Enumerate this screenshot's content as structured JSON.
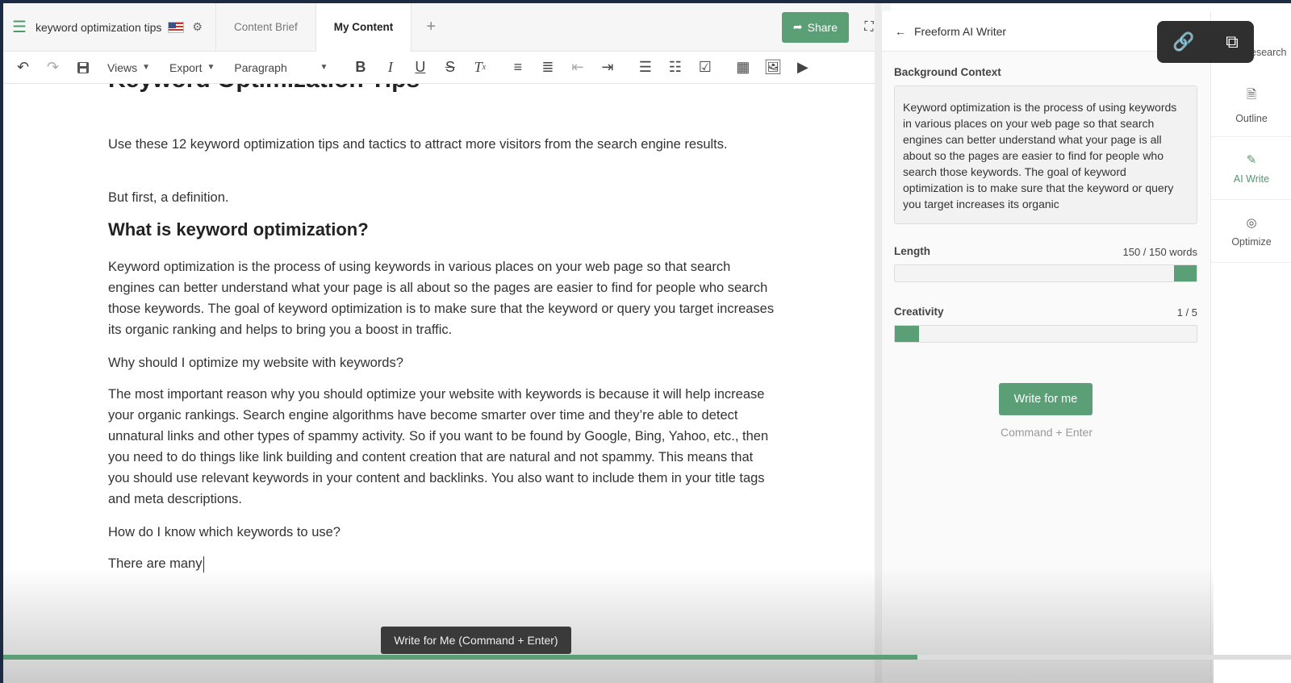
{
  "topbar": {
    "doc_title": "keyword optimization tips",
    "tabs": [
      {
        "label": "Content Brief"
      },
      {
        "label": "My Content"
      }
    ],
    "add_tab": "+",
    "share_label": "Share"
  },
  "toolbar": {
    "views_label": "Views",
    "export_label": "Export",
    "block_format": "Paragraph"
  },
  "document": {
    "h1_partial": "Keyword Optimization Tips",
    "p1": "Use these 12 keyword optimization tips and tactics to attract more visitors from the search engine results.",
    "p2": "But first, a definition.",
    "h2": "What is keyword optimization?",
    "p3": "Keyword optimization is the process of using keywords in various places on your web page so that search engines can better understand what your page is all about so the pages are easier to find for people who search those keywords. The goal of keyword optimization is to make sure that the keyword or query you target increases its organic ranking and helps to bring you a boost in traffic.",
    "p4": "Why should I optimize my website with keywords?",
    "p5": "The most important reason why you should optimize your website with keywords is because it will help increase your organic rankings. Search engine algorithms have become smarter over time and they’re able to detect unnatural links and other types of spammy activity. So if you want to be found by Google, Bing, Yahoo, etc., then you need to do things like link building and content creation that are natural and not spammy. This means that you should use relevant keywords in your content and backlinks. You also want to include them in your title tags and meta descriptions.",
    "p6": "How do I know which keywords to use?",
    "p7": "There are many"
  },
  "tooltip": "Write for Me (Command + Enter)",
  "video_progress": 0.71,
  "ai_panel": {
    "title": "Freeform AI Writer",
    "background_label": "Background Context",
    "background_text": "Keyword optimization is the process of using keywords in various places on your web page so that search engines can better understand what your page is all about so the pages are easier to find for people who search those keywords. The goal of keyword optimization is to make sure that the keyword or query you target increases its organic",
    "length_label": "Length",
    "length_value": "150 / 150 words",
    "length_fraction": 1.0,
    "creativity_label": "Creativity",
    "creativity_value": "1 / 5",
    "creativity_fraction": 0.2,
    "write_button": "Write for me",
    "write_hint": "Command + Enter"
  },
  "side_rail": {
    "research_label": "Research",
    "items": [
      {
        "label": "Outline"
      },
      {
        "label": "AI Write"
      },
      {
        "label": "Optimize"
      }
    ]
  },
  "colors": {
    "accent": "#5b9f77",
    "frame": "#1d2a44"
  }
}
